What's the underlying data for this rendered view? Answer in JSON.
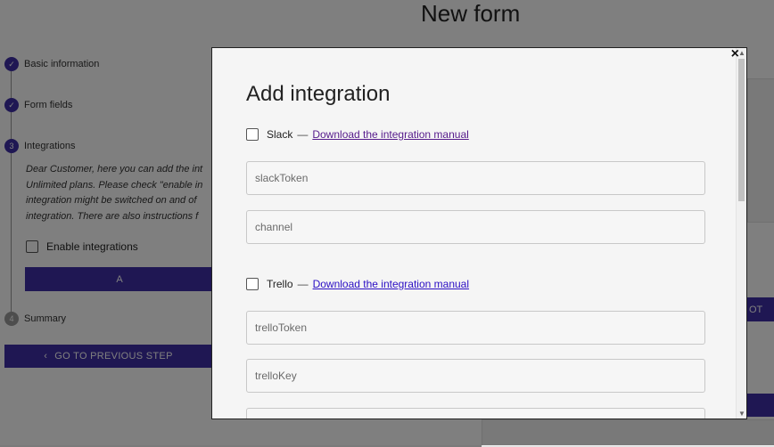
{
  "page": {
    "title": "New form",
    "steps": [
      {
        "marker": "✓",
        "label": "Basic information"
      },
      {
        "marker": "✓",
        "label": "Form fields"
      },
      {
        "marker": "3",
        "label": "Integrations"
      },
      {
        "marker": "4",
        "label": "Summary"
      }
    ],
    "step_text_lines": [
      "Dear Customer, here you can add the int",
      "Unlimited plans. Please check \"enable in",
      "integration might be switched on and of",
      "integration. There are also instructions f"
    ],
    "enable_label": "Enable integrations",
    "add_button_label": "A",
    "prev_button_label": "GO TO PREVIOUS STEP",
    "next_button_label": "OT"
  },
  "modal": {
    "close_glyph": "×",
    "title": "Add integration",
    "integrations": [
      {
        "name": "Slack",
        "separator": "—",
        "link": "Download the integration manual",
        "fields": [
          {
            "placeholder": "slackToken",
            "value": ""
          },
          {
            "placeholder": "channel",
            "value": ""
          }
        ]
      },
      {
        "name": "Trello",
        "separator": "—",
        "link": "Download the integration manual",
        "fields": [
          {
            "placeholder": "trelloToken",
            "value": ""
          },
          {
            "placeholder": "trelloKey",
            "value": ""
          },
          {
            "placeholder": "",
            "value": ""
          }
        ]
      }
    ]
  },
  "colors": {
    "primary": "#3f2ea6",
    "link": "#2b0fc4",
    "link_visited": "#551a8b",
    "overlay": "rgba(0,0,0,0.5)"
  }
}
